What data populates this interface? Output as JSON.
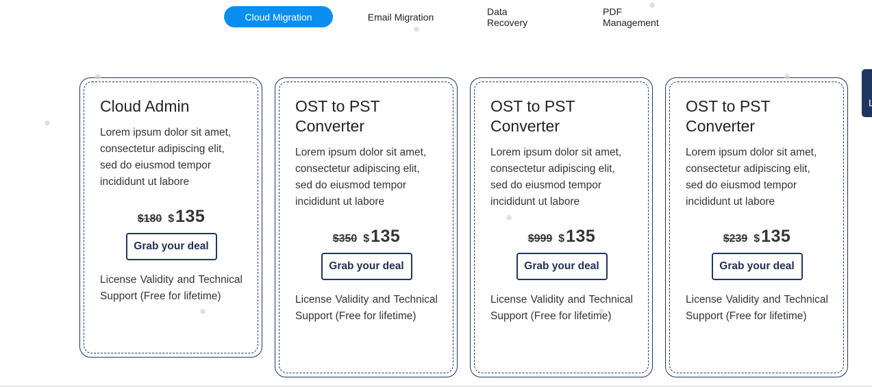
{
  "tabs": [
    {
      "label": "Cloud Migration",
      "active": true
    },
    {
      "label": "Email Migration",
      "active": false
    },
    {
      "label": "Data Recovery",
      "active": false
    },
    {
      "label": "PDF Management",
      "active": false
    }
  ],
  "cards": [
    {
      "title": "Cloud Admin",
      "description": "Lorem ipsum dolor sit amet, consectetur adipiscing elit, sed do eiusmod tempor incididunt ut labore",
      "currency": "$",
      "old_price": "180",
      "new_price": "135",
      "button_label": "Grab your deal",
      "license": "License Validity and Technical Support (Free for lifetime)"
    },
    {
      "title": "OST to PST Converter",
      "description": "Lorem ipsum dolor sit amet, consectetur adipiscing elit, sed do eiusmod tempor incididunt ut labore",
      "currency": "$",
      "old_price": "350",
      "new_price": "135",
      "button_label": "Grab your deal",
      "license": "License Validity and Technical Support (Free for lifetime)"
    },
    {
      "title": "OST to PST Converter",
      "description": "Lorem ipsum dolor sit amet, consectetur adipiscing elit, sed do eiusmod tempor incididunt ut labore",
      "currency": "$",
      "old_price": "999",
      "new_price": "135",
      "button_label": "Grab your deal",
      "license": "License Validity and Technical Support (Free for lifetime)"
    },
    {
      "title": "OST to PST Converter",
      "description": "Lorem ipsum dolor sit amet, consectetur adipiscing elit, sed do eiusmod tempor incididunt ut labore",
      "currency": "$",
      "old_price": "239",
      "new_price": "135",
      "button_label": "Grab your deal",
      "license": "License Validity and Technical Support (Free for lifetime)"
    }
  ],
  "side_tab": {
    "letter": "L"
  },
  "decor": {
    "snowflake": "❅"
  },
  "colors": {
    "accent": "#0a8ff0",
    "navy": "#1e3560"
  }
}
